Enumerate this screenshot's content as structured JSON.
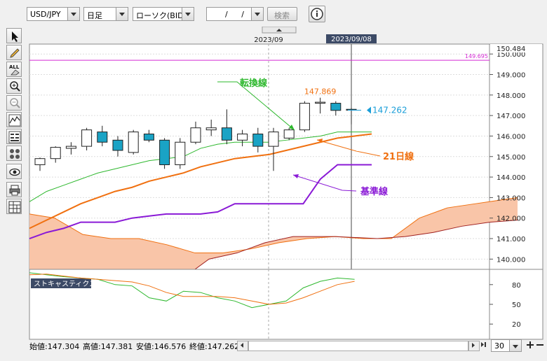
{
  "toolbar": {
    "symbol": "USD/JPY",
    "timeframe": "日足",
    "chart_type": "ローソク(BID)",
    "date_value": "/ /",
    "search_label": "検索",
    "info_icon": "info-icon"
  },
  "tools": [
    "cursor-icon",
    "pencil-icon",
    "eraser-all-icon",
    "zoom-in-icon",
    "zoom-out-icon",
    "indicator-icon",
    "data-table-icon",
    "settings-icon",
    "eye-icon",
    "print-icon",
    "layout-icon"
  ],
  "tools_text": {
    "all": "ALL"
  },
  "colors": {
    "up_candle": "#ffffff",
    "down_candle": "#1aa3c5",
    "tenkan": "#2eb82e",
    "kijun": "#8a1ad6",
    "ma21": "#f07010",
    "cloud": "#f9c5a8",
    "current": "#1a9ed8",
    "resistance": "#d42ad4",
    "stoch_k": "#2eb82e",
    "stoch_d": "#f07010"
  },
  "chart_data": [
    {
      "type": "candlestick",
      "x_labels": [
        "2023/09"
      ],
      "crosshair_label": "2023/09/08",
      "y_ticks": [
        140.0,
        141.0,
        142.0,
        143.0,
        144.0,
        145.0,
        146.0,
        147.0,
        148.0,
        149.0,
        150.0
      ],
      "ylim": [
        139.5,
        150.484
      ],
      "y_top_label": "150.484",
      "resistance_line": {
        "value": 149.695,
        "label": "149.695"
      },
      "current_price": {
        "value": 147.262,
        "label": "147.262"
      },
      "high_label": {
        "value": 147.869,
        "label": "147.869"
      },
      "candles": [
        {
          "o": 144.6,
          "h": 144.95,
          "l": 144.3,
          "c": 144.9
        },
        {
          "o": 144.9,
          "h": 145.5,
          "l": 144.7,
          "c": 145.45
        },
        {
          "o": 145.4,
          "h": 145.7,
          "l": 145.1,
          "c": 145.5
        },
        {
          "o": 145.5,
          "h": 146.4,
          "l": 145.3,
          "c": 146.3
        },
        {
          "o": 146.2,
          "h": 146.5,
          "l": 145.5,
          "c": 145.7
        },
        {
          "o": 145.8,
          "h": 146.0,
          "l": 145.0,
          "c": 145.3
        },
        {
          "o": 145.2,
          "h": 146.3,
          "l": 145.1,
          "c": 146.2
        },
        {
          "o": 146.1,
          "h": 146.3,
          "l": 145.7,
          "c": 145.8
        },
        {
          "o": 145.8,
          "h": 145.9,
          "l": 144.4,
          "c": 144.6
        },
        {
          "o": 144.6,
          "h": 145.9,
          "l": 144.4,
          "c": 145.7
        },
        {
          "o": 145.7,
          "h": 146.7,
          "l": 145.6,
          "c": 146.4
        },
        {
          "o": 146.3,
          "h": 146.8,
          "l": 146.0,
          "c": 146.4
        },
        {
          "o": 146.4,
          "h": 147.3,
          "l": 145.6,
          "c": 145.8
        },
        {
          "o": 145.8,
          "h": 146.3,
          "l": 145.5,
          "c": 146.1
        },
        {
          "o": 146.1,
          "h": 146.4,
          "l": 145.2,
          "c": 145.5
        },
        {
          "o": 145.5,
          "h": 146.4,
          "l": 144.3,
          "c": 146.2
        },
        {
          "o": 145.9,
          "h": 146.4,
          "l": 145.8,
          "c": 146.3
        },
        {
          "o": 146.3,
          "h": 147.7,
          "l": 146.2,
          "c": 147.6
        },
        {
          "o": 147.6,
          "h": 147.869,
          "l": 147.1,
          "c": 147.65
        },
        {
          "o": 147.6,
          "h": 147.7,
          "l": 147.0,
          "c": 147.25
        },
        {
          "o": 147.304,
          "h": 147.381,
          "l": 146.576,
          "c": 147.262
        }
      ],
      "annotations": [
        {
          "text": "転換線",
          "color": "#2eb82e"
        },
        {
          "text": "21日線",
          "color": "#f07010"
        },
        {
          "text": "基準線",
          "color": "#8a1ad6"
        }
      ]
    },
    {
      "type": "line",
      "title": "ストキャスティクス",
      "y_ticks": [
        20,
        50,
        80
      ],
      "ylim": [
        0,
        100
      ]
    }
  ],
  "status": {
    "open": "始値:147.304",
    "high": "高値:147.381",
    "low": "安値:146.576",
    "close": "終値:147.262",
    "period": "30"
  }
}
